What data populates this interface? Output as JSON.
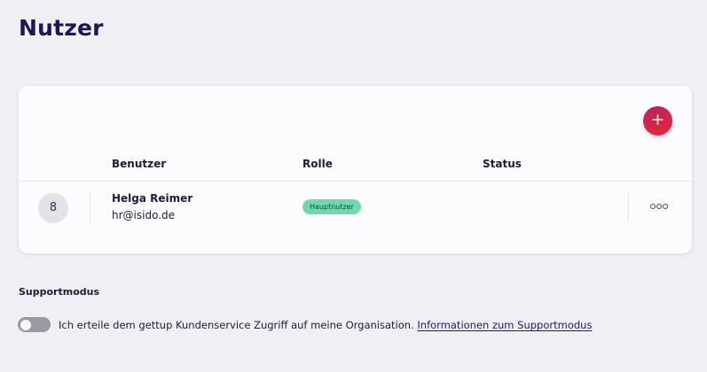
{
  "page": {
    "title": "Nutzer"
  },
  "users_table": {
    "add_button_label": "+",
    "columns": [
      "Benutzer",
      "Rolle",
      "Status"
    ],
    "rows": [
      {
        "avatar_icon": "user-icon",
        "avatar_glyph": "8",
        "name": "Helga Reimer",
        "email": "hr@isido.de",
        "role": "Hauptnutzer",
        "status": "",
        "more_icon": "more-options-icon"
      }
    ]
  },
  "support_mode": {
    "title": "Supportmodus",
    "toggle_on": false,
    "consent_text": "Ich erteile dem gettup Kundenservice Zugriff auf meine Organisation.",
    "link_text": "Informationen zum Supportmodus"
  },
  "colors": {
    "background": "#f0eff4",
    "card": "#fcfbfd",
    "title": "#1c1656",
    "accent_gradient_start": "#b3245e",
    "accent_gradient_end": "#e8273c",
    "role_badge": "#6fd9ad",
    "toggle_off": "#9b98a4",
    "link": "#1c1a6e"
  }
}
